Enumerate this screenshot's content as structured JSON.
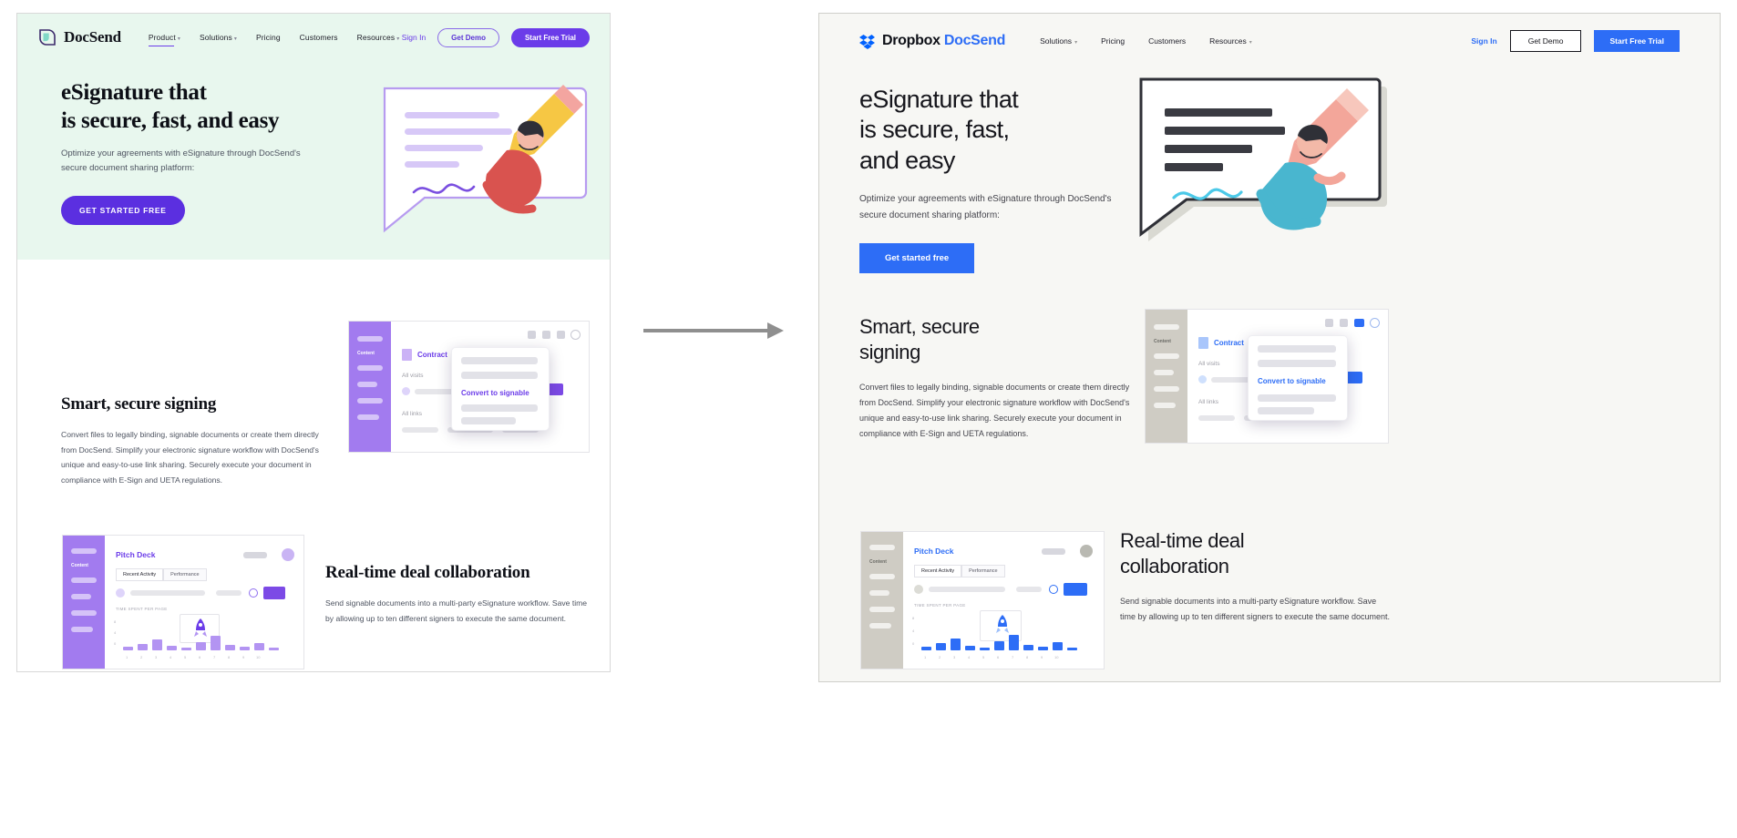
{
  "old_site": {
    "brand": {
      "name": "DocSend",
      "logo_icon": "docsend-shield-icon",
      "accent": "#6b3ce9"
    },
    "nav": [
      {
        "label": "Product",
        "has_caret": true,
        "active": true
      },
      {
        "label": "Solutions",
        "has_caret": true,
        "active": false
      },
      {
        "label": "Pricing",
        "has_caret": false,
        "active": false
      },
      {
        "label": "Customers",
        "has_caret": false,
        "active": false
      },
      {
        "label": "Resources",
        "has_caret": true,
        "active": false
      }
    ],
    "sign_in": "Sign In",
    "demo_button": "Get Demo",
    "trial_button": "Start Free Trial",
    "hero": {
      "heading_line1": "eSignature that",
      "heading_line2": "is secure, fast, and easy",
      "subtext": "Optimize your agreements with eSignature through DocSend's secure document sharing platform:",
      "cta": "GET STARTED FREE",
      "bg_color": "#e8f7ee"
    },
    "section_signing": {
      "heading": "Smart, secure signing",
      "body": "Convert files to legally binding, signable documents or create them directly from DocSend. Simplify your electronic signature workflow with DocSend's unique and easy-to-use link sharing. Securely execute your document in compliance with E-Sign and UETA regulations."
    },
    "section_collab": {
      "heading": "Real-time deal collaboration",
      "body": "Send signable documents into a multi-party eSignature workflow. Save time by allowing up to ten different signers to execute the same document."
    },
    "mockup_signing": {
      "rail_label": "Content",
      "doc_title": "Contract",
      "stat_visits": "All visits",
      "stat_links": "All links",
      "overlay_cta": "Convert to signable",
      "rail_color": "#a27bef"
    },
    "mockup_collab": {
      "rail_label": "Content",
      "doc_title": "Pitch Deck",
      "tabs": [
        "Recent Activity",
        "Performance"
      ],
      "chart_caption": "TIME SPENT PER PAGE",
      "rail_color": "#a27bef",
      "bar_color": "#b394f2"
    }
  },
  "new_site": {
    "brand": {
      "name_primary": "Dropbox",
      "name_secondary": "DocSend",
      "logo_icon": "dropbox-box-icon",
      "accent": "#2d6df6"
    },
    "nav": [
      {
        "label": "Solutions",
        "has_caret": true
      },
      {
        "label": "Pricing",
        "has_caret": false
      },
      {
        "label": "Customers",
        "has_caret": false
      },
      {
        "label": "Resources",
        "has_caret": true
      }
    ],
    "sign_in": "Sign In",
    "demo_button": "Get Demo",
    "trial_button": "Start Free Trial",
    "hero": {
      "heading_line1": "eSignature that",
      "heading_line2": "is secure, fast,",
      "heading_line3": "and easy",
      "subtext": "Optimize your agreements with eSignature through DocSend's secure document sharing platform:",
      "cta": "Get started free",
      "bg_color": "#f7f7f4"
    },
    "section_signing": {
      "heading_line1": "Smart, secure",
      "heading_line2": "signing",
      "body": "Convert files to legally binding, signable documents or create them directly from DocSend. Simplify your electronic signature workflow with DocSend's unique and easy-to-use link sharing. Securely execute your document in compliance with E-Sign and UETA regulations."
    },
    "section_collab": {
      "heading_line1": "Real-time deal",
      "heading_line2": "collaboration",
      "body": "Send signable documents into a multi-party eSignature workflow. Save time by allowing up to ten different signers to execute the same document."
    },
    "mockup_signing": {
      "rail_label": "Content",
      "doc_title": "Contract",
      "stat_visits": "All visits",
      "stat_links": "All links",
      "overlay_cta": "Convert to signable",
      "rail_color": "#cfccc4"
    },
    "mockup_collab": {
      "rail_label": "Content",
      "doc_title": "Pitch Deck",
      "tabs": [
        "Recent Activity",
        "Performance"
      ],
      "chart_caption": "TIME SPENT PER PAGE",
      "rail_color": "#cfccc4",
      "bar_color": "#2d6df6"
    }
  },
  "arrow": {
    "icon": "right-arrow-icon",
    "color": "#8f8f8f"
  }
}
